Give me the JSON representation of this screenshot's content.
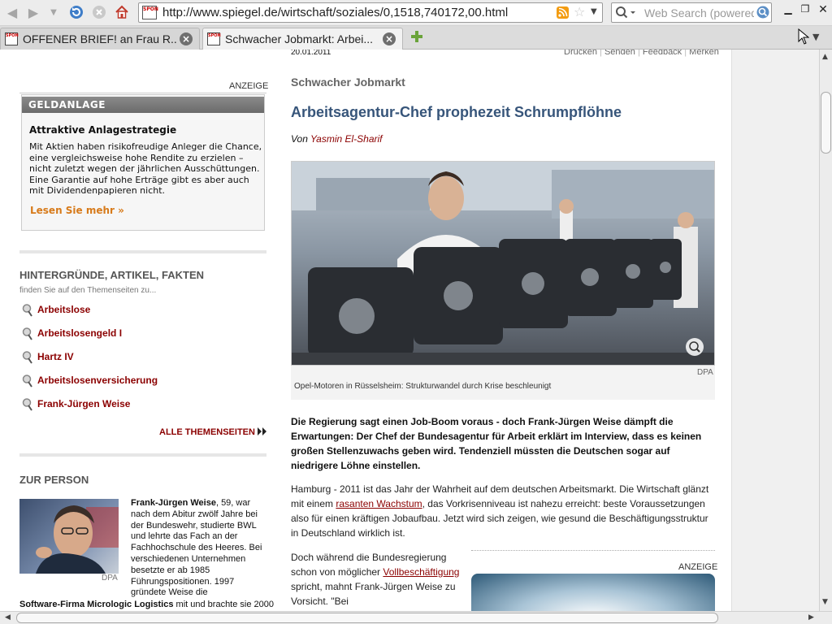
{
  "browser": {
    "url": "http://www.spiegel.de/wirtschaft/soziales/0,1518,740172,00.html",
    "search_placeholder": "Web Search (powered",
    "site_icon_text": "SPON",
    "tabs": [
      {
        "title": "OFFENER BRIEF! an Frau R..."
      },
      {
        "title": "Schwacher Jobmarkt: Arbei..."
      }
    ]
  },
  "article": {
    "date": "20.01.2011",
    "tools": [
      "Drucken",
      "Senden",
      "Feedback",
      "Merken"
    ],
    "kicker": "Schwacher Jobmarkt",
    "headline": "Arbeitsagentur-Chef prophezeit Schrumpflöhne",
    "byline_prefix": "Von",
    "author": "Yasmin El-Sharif",
    "image_credit": "DPA",
    "caption": "Opel-Motoren in Rüsselsheim: Strukturwandel durch Krise beschleunigt",
    "intro": "Die Regierung sagt einen Job-Boom voraus - doch Frank-Jürgen Weise dämpft die Erwartungen: Der Chef der Bundesagentur für Arbeit erklärt im Interview, dass es keinen großen Stellenzuwachs geben wird. Tendenziell müssten die Deutschen sogar auf niedrigere Löhne einstellen.",
    "p1_a": "Hamburg - 2011 ist das Jahr der Wahrheit auf dem deutschen Arbeitsmarkt. Die Wirtschaft glänzt mit einem ",
    "p1_link": "rasanten Wachstum",
    "p1_b": ", das Vorkrisenniveau ist nahezu erreicht: beste Voraussetzungen also für einen kräftigen Jobaufbau. Jetzt wird sich zeigen, wie gesund die Beschäftigungsstruktur in Deutschland wirklich ist.",
    "p2_a": "Doch während die Bundesregierung schon von möglicher ",
    "p2_link": "Vollbeschäftigung",
    "p2_b": " spricht, mahnt Frank-Jürgen Weise zu Vorsicht. \"Bei",
    "ad_label": "ANZEIGE"
  },
  "sidebar": {
    "ad_label": "ANZEIGE",
    "ad_box_title": "GELDANLAGE",
    "ad_heading": "Attraktive Anlagestrategie",
    "ad_text": "Mit Aktien haben risikofreudige Anleger die Chance, eine vergleichsweise hohe Rendite zu erzielen – nicht zuletzt wegen der jährlichen Ausschüttungen. Eine Garantie auf hohe Erträge gibt es aber auch mit Dividendenpapieren nicht.",
    "ad_link": "Lesen Sie mehr",
    "topics_heading": "HINTERGRÜNDE, ARTIKEL, FAKTEN",
    "topics_sub": "finden Sie auf den Themenseiten zu...",
    "topics": [
      "Arbeitslose",
      "Arbeitslosengeld I",
      "Hartz IV",
      "Arbeitslosenversicherung",
      "Frank-Jürgen Weise"
    ],
    "all_topics": "ALLE THEMENSEITEN",
    "person_heading": "ZUR PERSON",
    "person_credit": "DPA",
    "person_name": "Frank-Jürgen Weise",
    "person_text": ", 59, war nach dem Abitur zwölf Jahre bei der Bundeswehr, studierte BWL und lehrte das Fach an der Fachhochschule des Heeres. Bei verschiedenen Unternehmen besetzte er ab 1985 Führungspositionen. 1997 gründete Weise die",
    "person_bold": "Software-Firma Micrologic Logistics",
    "person_tail": " mit und brachte sie 2000"
  }
}
